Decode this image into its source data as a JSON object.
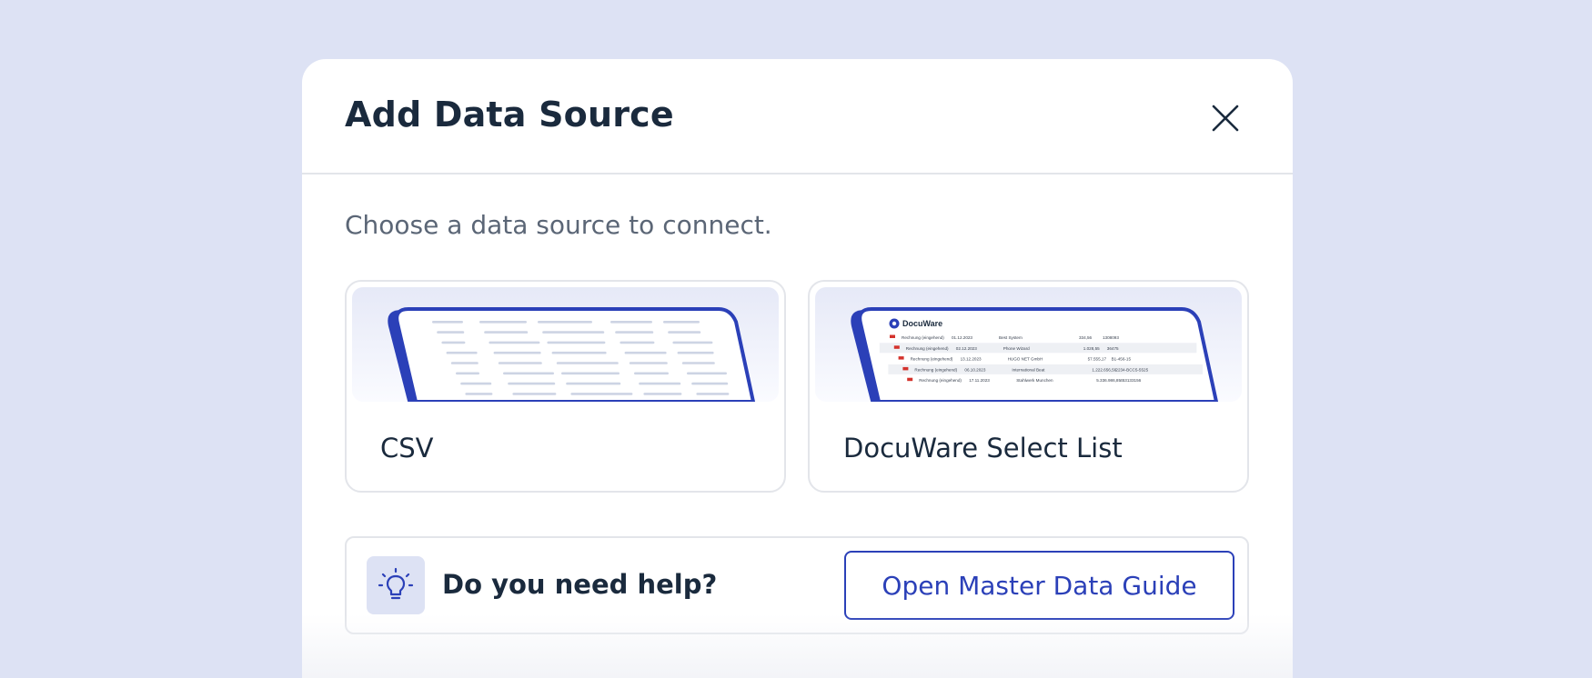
{
  "dialog": {
    "title": "Add Data Source",
    "subtitle": "Choose a data source to connect.",
    "close_icon": "close-icon"
  },
  "sources": [
    {
      "label": "CSV",
      "preview": "csv-preview-illustration"
    },
    {
      "label": "DocuWare Select List",
      "preview": "docuware-list-preview-illustration"
    }
  ],
  "docuware_preview": {
    "logo_text": "DocuWare",
    "rows": [
      {
        "col1": "Rechnung (eingehend)",
        "col2": "01.12.2023",
        "col3": "Best System",
        "col4": "334,56",
        "col5": "1308093"
      },
      {
        "col1": "Rechnung (eingehend)",
        "col2": "02.12.2023",
        "col3": "Phone Wizard",
        "col4": "1.028,55",
        "col5": "36475"
      },
      {
        "col1": "Rechnung (eingehend)",
        "col2": "13.12.2023",
        "col3": "HUGO NET GmbH",
        "col4": "57.555,17",
        "col5": "B1-456-15"
      },
      {
        "col1": "Rechnung (eingehend)",
        "col2": "06.10.2023",
        "col3": "International Beat",
        "col4": "1.222.656,56",
        "col5": "2234-BCC5-5525"
      },
      {
        "col1": "Rechnung (eingehend)",
        "col2": "17.11.2023",
        "col3": "Stahlwerk Munchen",
        "col4": "5.336.986,85",
        "col5": "453133156"
      }
    ]
  },
  "help": {
    "icon": "lightbulb-icon",
    "text": "Do you need help?",
    "button_label": "Open Master Data Guide"
  },
  "colors": {
    "accent": "#2b40b8",
    "backdrop": "#dde2f4",
    "title": "#1a2a3d",
    "subtitle": "#5b6676",
    "border": "#e3e5ea"
  }
}
